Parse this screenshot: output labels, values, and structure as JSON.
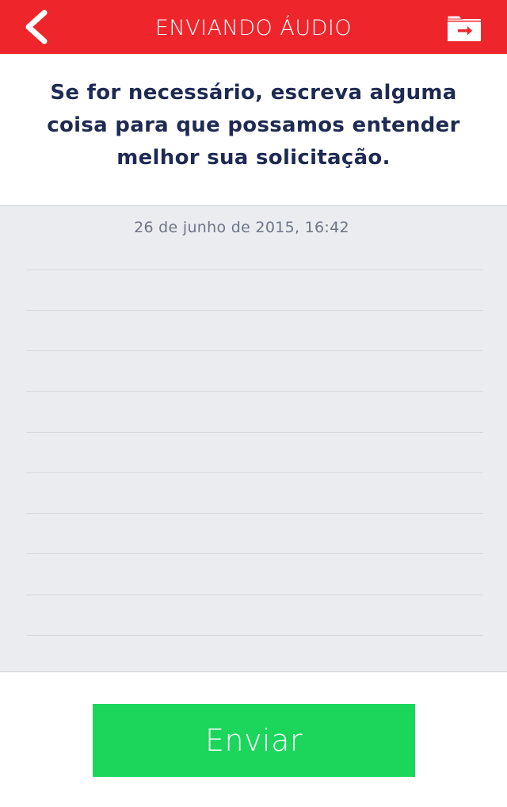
{
  "header": {
    "title": "ENVIANDO ÁUDIO",
    "back_icon": "chevron-left-icon",
    "folder_icon": "folder-export-icon",
    "background_color": "#ee262c"
  },
  "instruction": {
    "text": "Se for necessário, escreva alguma coisa para que possamos entender melhor sua solicitação."
  },
  "note": {
    "timestamp": "26 de junho de 2015, 16:42",
    "value": ""
  },
  "actions": {
    "send_label": "Enviar",
    "send_color": "#1cd65c"
  }
}
